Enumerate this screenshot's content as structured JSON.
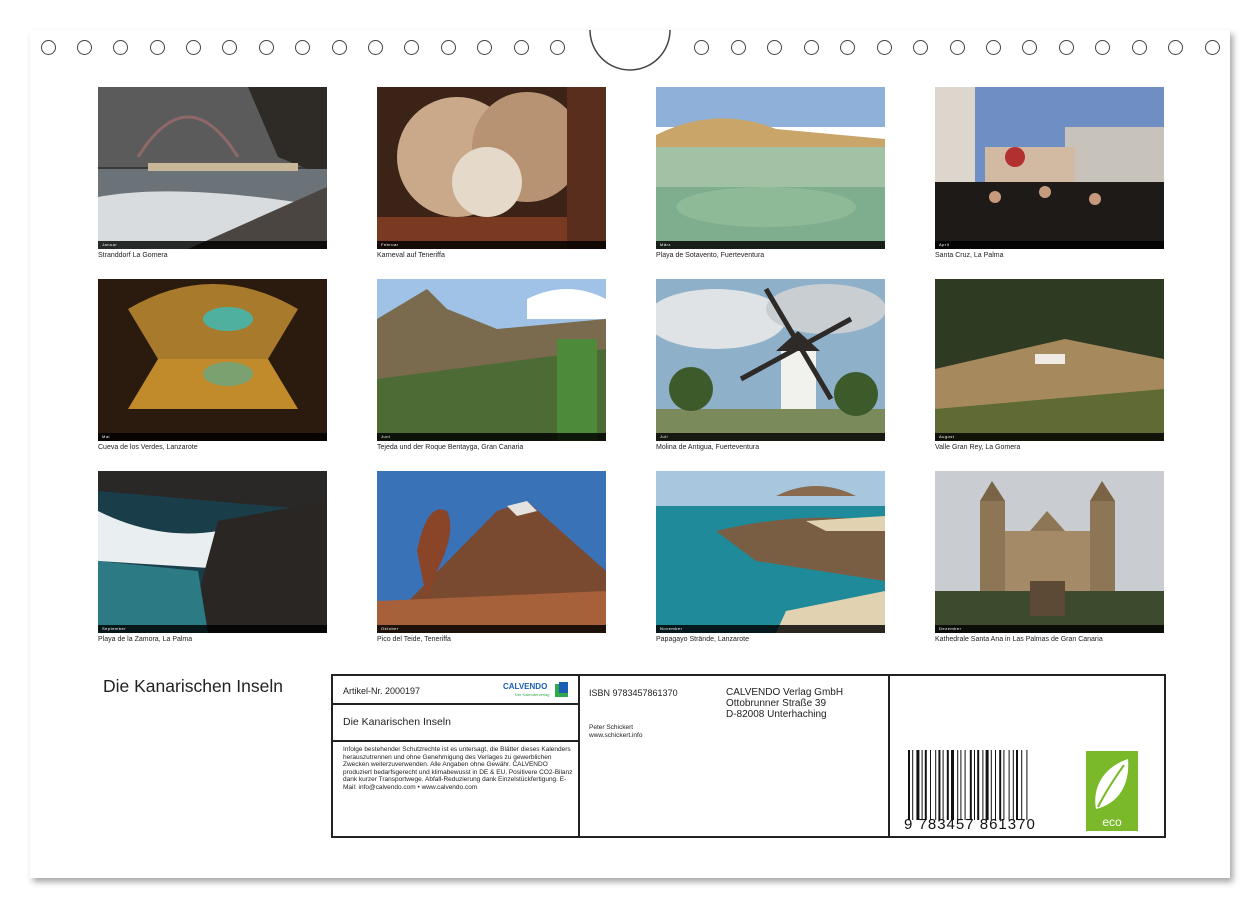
{
  "calendar_title": "Die Kanarischen Inseln",
  "photos": [
    {
      "caption": "Stranddorf La Gomera",
      "month": "Januar"
    },
    {
      "caption": "Karneval auf Teneriffa",
      "month": "Februar"
    },
    {
      "caption": "Playa de Sotavento, Fuerteventura",
      "month": "März"
    },
    {
      "caption": "Santa Cruz, La Palma",
      "month": "April"
    },
    {
      "caption": "Cueva de los Verdes, Lanzarote",
      "month": "Mai"
    },
    {
      "caption": "Tejeda und der Roque Bentayga, Gran Canaria",
      "month": "Juni"
    },
    {
      "caption": "Molina de Antigua, Fuerteventura",
      "month": "Juli"
    },
    {
      "caption": "Valle Gran Rey, La Gomera",
      "month": "August"
    },
    {
      "caption": "Playa de la Zamora, La Palma",
      "month": "September"
    },
    {
      "caption": "Pico del Teide, Teneriffa",
      "month": "Oktober"
    },
    {
      "caption": "Papagayo Strände, Lanzarote",
      "month": "November"
    },
    {
      "caption": "Kathedrale Santa Ana in Las Palmas de Gran Canaria",
      "month": "Dezember"
    }
  ],
  "info": {
    "article_no": "Artikel-Nr. 2000197",
    "brand": "CALVENDO",
    "brand_sub": "Der Kalenderverlag",
    "product_title": "Die Kanarischen Inseln",
    "legal_text": "Infolge bestehender Schutzrechte ist es untersagt, die Blätter dieses Kalenders herauszutrennen und ohne Genehmigung des Verlages zu gewerblichen Zwecken weiterzuverwenden. Alle Angaben ohne Gewähr. CALVENDO produziert bedarfsgerecht und klimabewusst in DE & EU. Positivere CO2-Bilanz dank kurzer Transportwege. Abfall-Reduzierung dank Einzelstückfertigung. E-Mail: info@calvendo.com • www.calvendo.com",
    "isbn": "ISBN 9783457861370",
    "publisher_name": "CALVENDO Verlag GmbH",
    "publisher_street": "Ottobrunner Straße 39",
    "publisher_city": "D-82008 Unterhaching",
    "author": "Peter Schickert",
    "author_web": "www.schickert.info",
    "barcode_digits": "9 783457 861370",
    "eco_label": "eco"
  },
  "colors": {
    "brand_green": "#2fa94a",
    "brand_blue": "#1a5fb4",
    "eco_green": "#7ab929"
  }
}
